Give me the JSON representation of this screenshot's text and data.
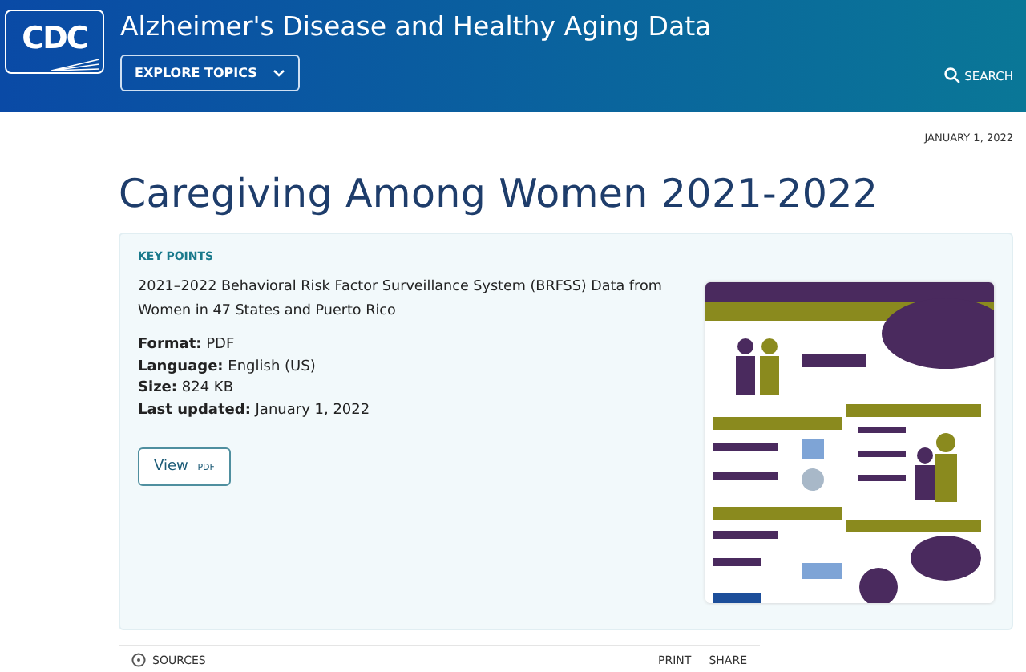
{
  "header": {
    "logo": "CDC",
    "title": "Alzheimer's Disease and Healthy Aging Data",
    "explore_button": "EXPLORE TOPICS",
    "search": "SEARCH"
  },
  "date": "JANUARY 1, 2022",
  "page_title": "Caregiving Among Women 2021-2022",
  "card": {
    "heading": "KEY POINTS",
    "description": "2021–2022 Behavioral Risk Factor Surveillance System (BRFSS) Data from Women in 47 States and Puerto Rico",
    "details": [
      {
        "label": "Format:",
        "value": "PDF"
      },
      {
        "label": "Language:",
        "value": "English (US)"
      },
      {
        "label": "Size:",
        "value": "824 KB"
      },
      {
        "label": "Last updated:",
        "value": "January 1, 2022"
      }
    ],
    "view_button": {
      "label": "View",
      "format": "PDF"
    }
  },
  "footer": {
    "sources": "SOURCES",
    "actions": [
      "PRINT",
      "SHARE"
    ]
  }
}
